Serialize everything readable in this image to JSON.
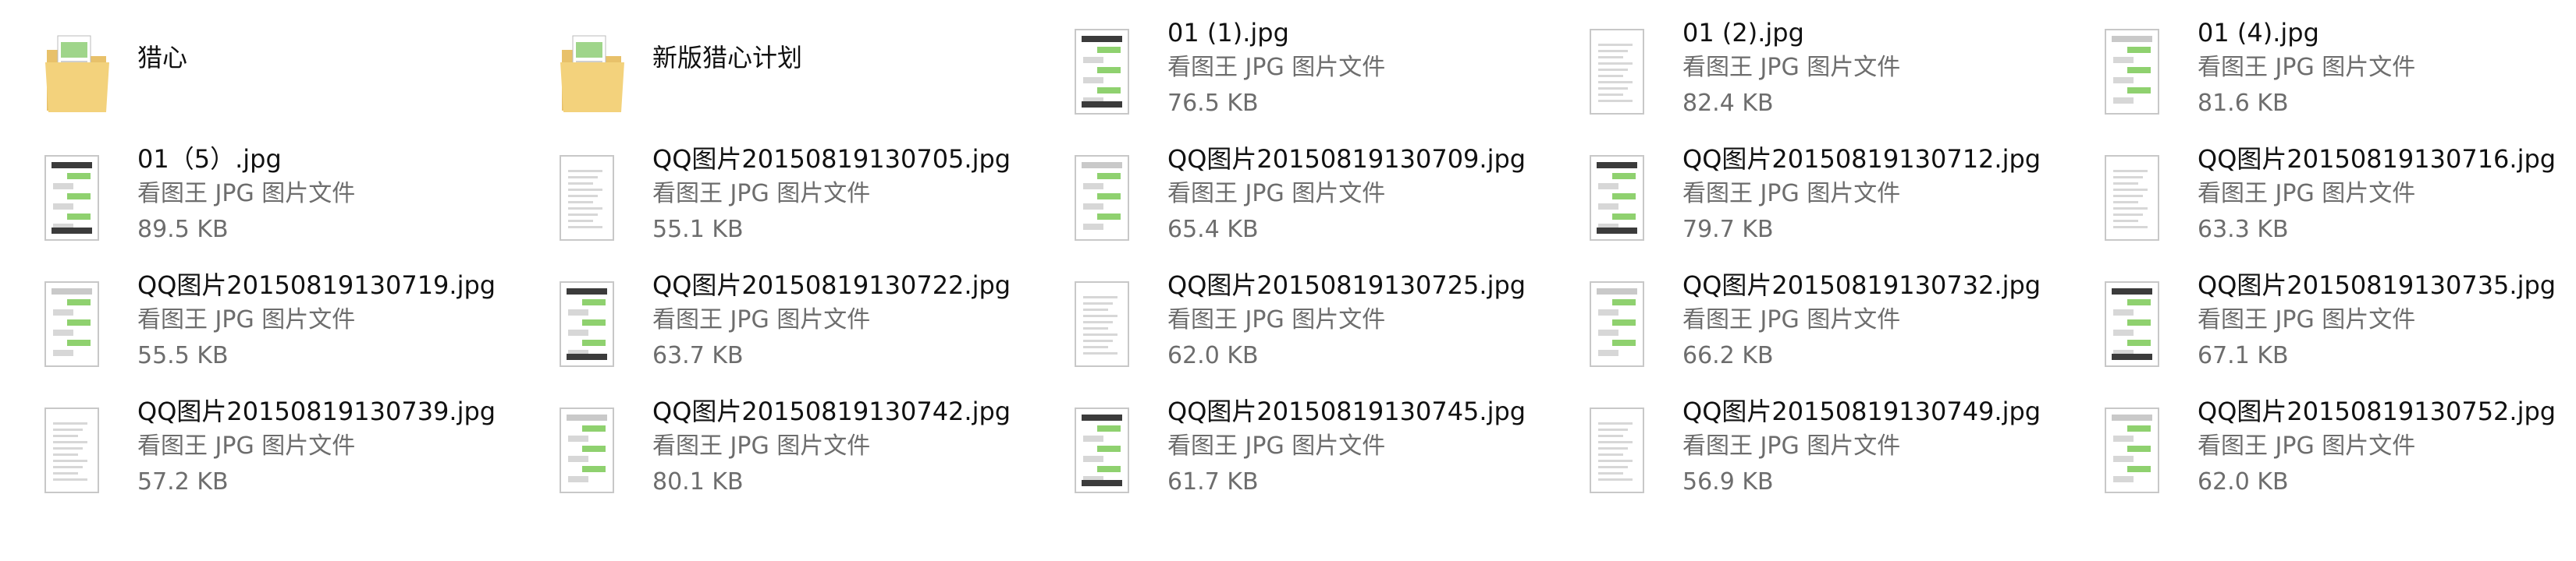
{
  "explorer": {
    "items": [
      {
        "kind": "folder",
        "name": "猎心",
        "icon": "folder-icon"
      },
      {
        "kind": "folder",
        "name": "新版猎心计划",
        "icon": "folder-icon"
      },
      {
        "kind": "file",
        "name": "01 (1).jpg",
        "type": "看图王 JPG 图片文件",
        "size": "76.5 KB",
        "icon": "image-thumbnail-icon"
      },
      {
        "kind": "file",
        "name": "01 (2).jpg",
        "type": "看图王 JPG 图片文件",
        "size": "82.4 KB",
        "icon": "image-thumbnail-icon"
      },
      {
        "kind": "file",
        "name": "01 (4).jpg",
        "type": "看图王 JPG 图片文件",
        "size": "81.6 KB",
        "icon": "image-thumbnail-icon"
      },
      {
        "kind": "file",
        "name": "01（5）.jpg",
        "type": "看图王 JPG 图片文件",
        "size": "89.5 KB",
        "icon": "image-thumbnail-icon"
      },
      {
        "kind": "file",
        "name": "QQ图片20150819130705.jpg",
        "type": "看图王 JPG 图片文件",
        "size": "55.1 KB",
        "icon": "image-thumbnail-icon"
      },
      {
        "kind": "file",
        "name": "QQ图片20150819130709.jpg",
        "type": "看图王 JPG 图片文件",
        "size": "65.4 KB",
        "icon": "image-thumbnail-icon"
      },
      {
        "kind": "file",
        "name": "QQ图片20150819130712.jpg",
        "type": "看图王 JPG 图片文件",
        "size": "79.7 KB",
        "icon": "image-thumbnail-icon"
      },
      {
        "kind": "file",
        "name": "QQ图片20150819130716.jpg",
        "type": "看图王 JPG 图片文件",
        "size": "63.3 KB",
        "icon": "image-thumbnail-icon"
      },
      {
        "kind": "file",
        "name": "QQ图片20150819130719.jpg",
        "type": "看图王 JPG 图片文件",
        "size": "55.5 KB",
        "icon": "image-thumbnail-icon"
      },
      {
        "kind": "file",
        "name": "QQ图片20150819130722.jpg",
        "type": "看图王 JPG 图片文件",
        "size": "63.7 KB",
        "icon": "image-thumbnail-icon"
      },
      {
        "kind": "file",
        "name": "QQ图片20150819130725.jpg",
        "type": "看图王 JPG 图片文件",
        "size": "62.0 KB",
        "icon": "image-thumbnail-icon"
      },
      {
        "kind": "file",
        "name": "QQ图片20150819130732.jpg",
        "type": "看图王 JPG 图片文件",
        "size": "66.2 KB",
        "icon": "image-thumbnail-icon"
      },
      {
        "kind": "file",
        "name": "QQ图片20150819130735.jpg",
        "type": "看图王 JPG 图片文件",
        "size": "67.1 KB",
        "icon": "image-thumbnail-icon"
      },
      {
        "kind": "file",
        "name": "QQ图片20150819130739.jpg",
        "type": "看图王 JPG 图片文件",
        "size": "57.2 KB",
        "icon": "image-thumbnail-icon"
      },
      {
        "kind": "file",
        "name": "QQ图片20150819130742.jpg",
        "type": "看图王 JPG 图片文件",
        "size": "80.1 KB",
        "icon": "image-thumbnail-icon"
      },
      {
        "kind": "file",
        "name": "QQ图片20150819130745.jpg",
        "type": "看图王 JPG 图片文件",
        "size": "61.7 KB",
        "icon": "image-thumbnail-icon"
      },
      {
        "kind": "file",
        "name": "QQ图片20150819130749.jpg",
        "type": "看图王 JPG 图片文件",
        "size": "56.9 KB",
        "icon": "image-thumbnail-icon"
      },
      {
        "kind": "file",
        "name": "QQ图片20150819130752.jpg",
        "type": "看图王 JPG 图片文件",
        "size": "62.0 KB",
        "icon": "image-thumbnail-icon"
      }
    ]
  }
}
